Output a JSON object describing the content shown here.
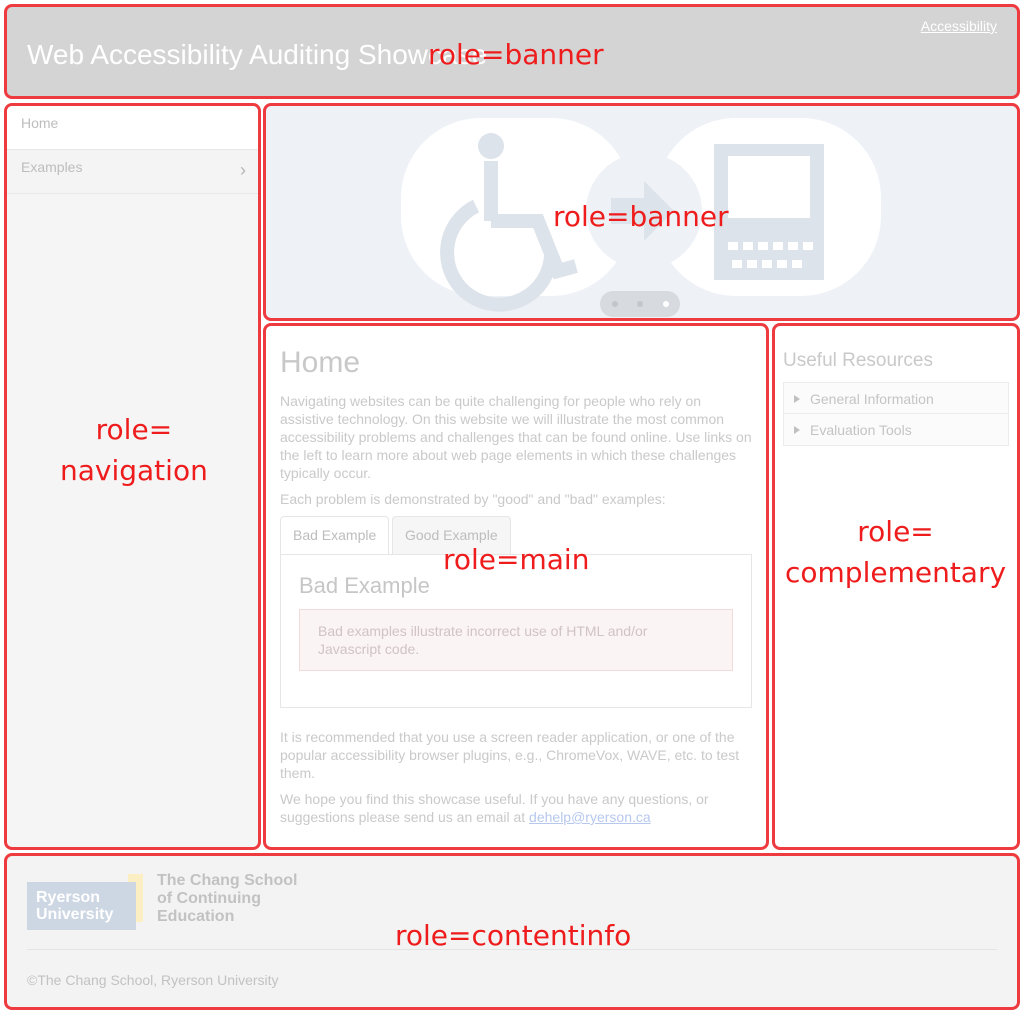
{
  "header": {
    "site_title": "Web Accessibility Auditing Showcase",
    "accessibility_link": "Accessibility"
  },
  "navigation": {
    "items": [
      {
        "label": "Home",
        "active": true
      },
      {
        "label": "Examples",
        "has_submenu": true
      }
    ]
  },
  "carousel": {
    "icons": [
      "wheelchair-icon",
      "arrow-right-icon",
      "computer-icon"
    ],
    "slide_count": 3,
    "active_slide": 3
  },
  "main": {
    "heading": "Home",
    "intro": "Navigating websites can be quite challenging for people who rely on assistive technology. On this website we will illustrate the most common accessibility problems and challenges that can be found online. Use links on the left to learn more about web page elements in which these challenges typically occur.",
    "examples_note": "Each problem is demonstrated by \"good\" and \"bad\" examples:",
    "tabs": [
      {
        "label": "Bad Example",
        "active": true
      },
      {
        "label": "Good Example"
      }
    ],
    "panel_heading": "Bad Example",
    "panel_text": "Bad examples illustrate incorrect use of HTML and/or Javascript code.",
    "recommend_text": "It is recommended that you use a screen reader application, or one of the popular accessibility browser plugins, e.g., ChromeVox, WAVE, etc. to test them.",
    "hope_text": "We hope you find this showcase useful. If you have any questions, or suggestions please send us an email at ",
    "email": "dehelp@ryerson.ca"
  },
  "aside": {
    "heading": "Useful Resources",
    "items": [
      "General Information",
      "Evaluation Tools"
    ]
  },
  "footer": {
    "logo_text_1": "Ryerson",
    "logo_text_2": "University",
    "school_line_1": "The Chang School",
    "school_line_2": "of Continuing",
    "school_line_3": "Education",
    "copyright": "©The Chang School, Ryerson University"
  },
  "roles": {
    "banner": "role=banner",
    "navigation_1": "role=",
    "navigation_2": "navigation",
    "main": "role=main",
    "complementary_1": "role=",
    "complementary_2": "complementary",
    "contentinfo": "role=contentinfo"
  },
  "colors": {
    "region_outline": "#ee3b3f",
    "role_label": "#ee1c1c",
    "header_bg": "#d4d4d4",
    "carousel_bg": "#eef2f7"
  }
}
